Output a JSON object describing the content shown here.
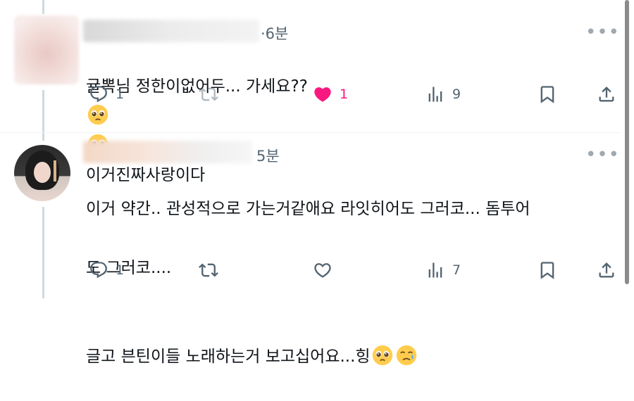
{
  "tweets": [
    {
      "time": "·6분",
      "text": "귤뽁님 정한이없어두... 가세요?? ",
      "text_after": " 이거진짜사랑이다",
      "emojis": [
        "pleading-face-emoji",
        "pleading-face-emoji"
      ],
      "actions": {
        "reply_count": "1",
        "retweet_count": "",
        "like_count": "1",
        "like_color": "#f91880",
        "view_count": "9"
      }
    },
    {
      "time": "5분",
      "text_line1": "이거 약간.. 관성적으로 가는거같애요 라잇히어도 그러코... 돔투어",
      "text_line2": "도 그러코....",
      "text_line3": "글고 븐틴이들 노래하는거 보고십어요...힝",
      "emojis": [
        "pleading-face-emoji",
        "sad-but-relieved-face-emoji"
      ],
      "actions": {
        "reply_count": "1",
        "retweet_count": "",
        "like_count": "",
        "view_count": "7"
      }
    }
  ],
  "colors": {
    "text": "#0f1419",
    "secondary": "#536471",
    "like": "#f91880",
    "thread_line": "#cfd9de"
  }
}
